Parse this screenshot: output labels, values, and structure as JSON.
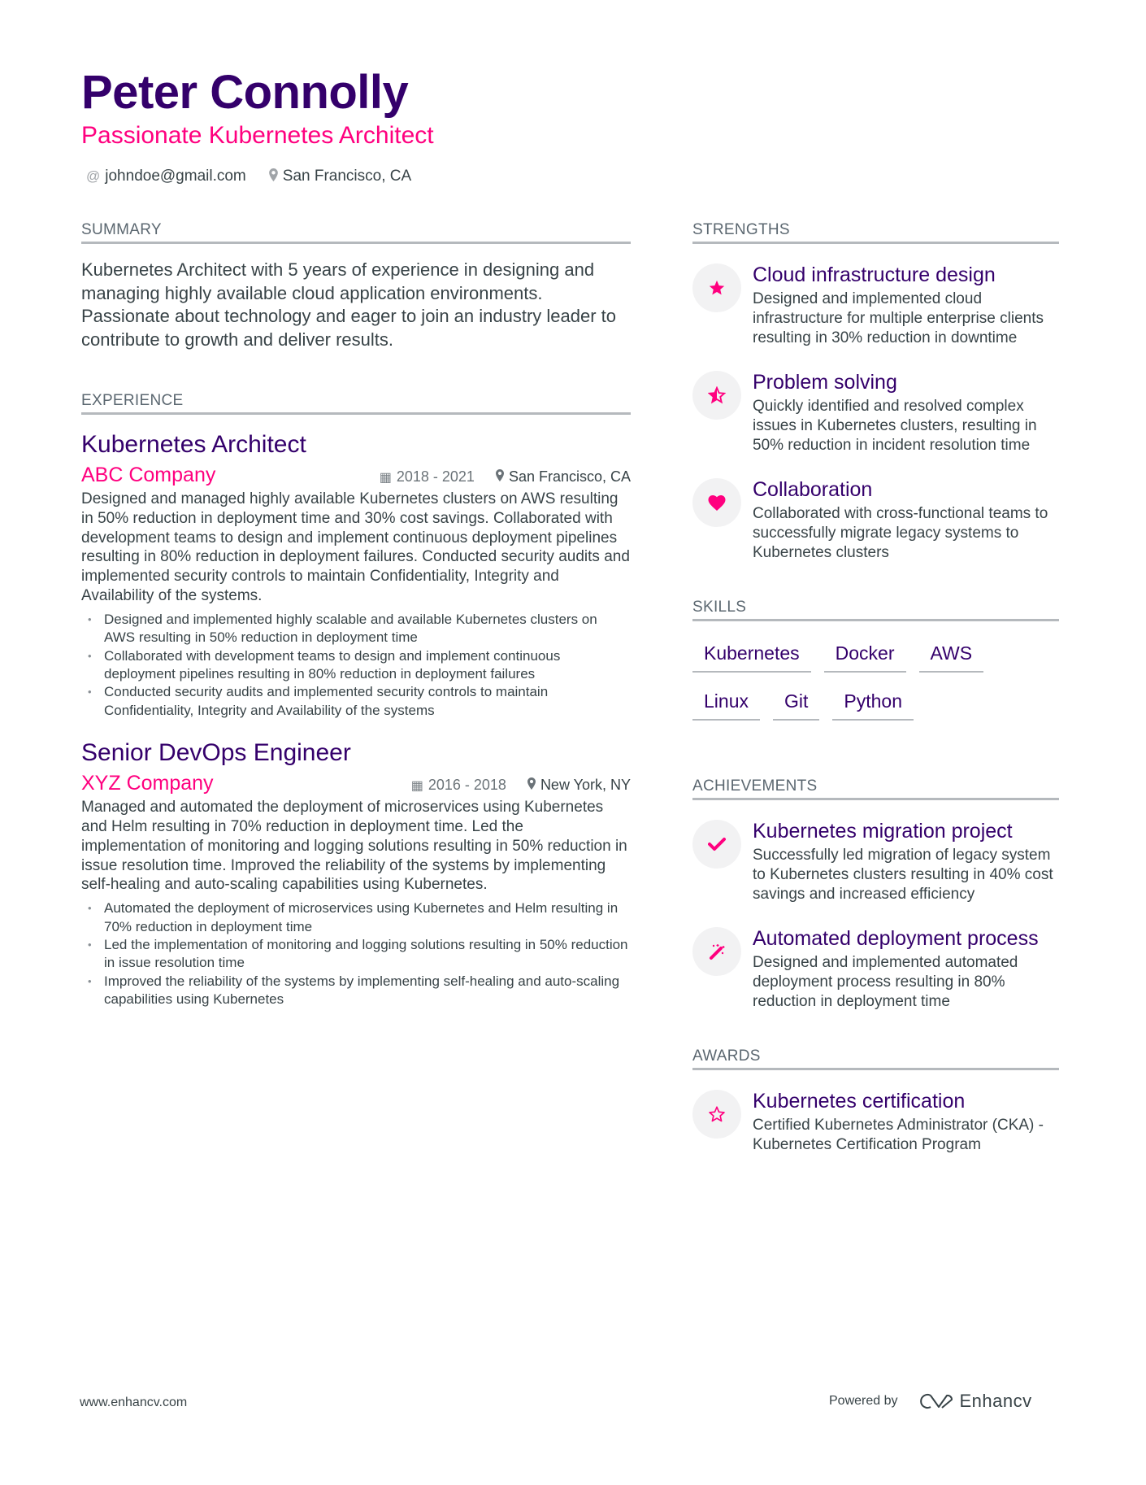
{
  "header": {
    "name": "Peter Connolly",
    "title": "Passionate Kubernetes Architect",
    "email": "johndoe@gmail.com",
    "location": "San Francisco, CA"
  },
  "summary": {
    "heading": "SUMMARY",
    "text": "Kubernetes Architect with 5 years of experience in designing and managing highly available cloud application environments. Passionate about technology and eager to join an industry leader to contribute to growth and deliver results."
  },
  "experience": {
    "heading": "EXPERIENCE",
    "jobs": [
      {
        "title": "Kubernetes Architect",
        "company": "ABC Company",
        "dates": "2018 - 2021",
        "location": "San Francisco, CA",
        "description": "Designed and managed highly available Kubernetes clusters on AWS resulting in 50% reduction in deployment time and 30% cost savings. Collaborated with development teams to design and implement continuous deployment pipelines resulting in 80% reduction in deployment failures. Conducted security audits and implemented security controls to maintain Confidentiality, Integrity and Availability of the systems.",
        "bullets": [
          "Designed and implemented highly scalable and available Kubernetes clusters on AWS resulting in 50% reduction in deployment time",
          "Collaborated with development teams to design and implement continuous deployment pipelines resulting in 80% reduction in deployment failures",
          "Conducted security audits and implemented security controls to maintain Confidentiality, Integrity and Availability of the systems"
        ]
      },
      {
        "title": "Senior DevOps Engineer",
        "company": "XYZ Company",
        "dates": "2016 - 2018",
        "location": "New York, NY",
        "description": "Managed and automated the deployment of microservices using Kubernetes and Helm resulting in 70% reduction in deployment time. Led the implementation of monitoring and logging solutions resulting in 50% reduction in issue resolution time. Improved the reliability of the systems by implementing self-healing and auto-scaling capabilities using Kubernetes.",
        "bullets": [
          "Automated the deployment of microservices using Kubernetes and Helm resulting in 70% reduction in deployment time",
          "Led the implementation of monitoring and logging solutions resulting in 50% reduction in issue resolution time",
          "Improved the reliability of the systems by implementing self-healing and auto-scaling capabilities using Kubernetes"
        ]
      }
    ]
  },
  "strengths": {
    "heading": "STRENGTHS",
    "items": [
      {
        "icon": "star-icon",
        "title": "Cloud infrastructure design",
        "description": "Designed and implemented cloud infrastructure for multiple enterprise clients resulting in 30% reduction in downtime"
      },
      {
        "icon": "half-star-icon",
        "title": "Problem solving",
        "description": "Quickly identified and resolved complex issues in Kubernetes clusters, resulting in 50% reduction in incident resolution time"
      },
      {
        "icon": "heart-icon",
        "title": "Collaboration",
        "description": "Collaborated with cross-functional teams to successfully migrate legacy systems to Kubernetes clusters"
      }
    ]
  },
  "skills": {
    "heading": "SKILLS",
    "items": [
      "Kubernetes",
      "Docker",
      "AWS",
      "Linux",
      "Git",
      "Python"
    ]
  },
  "achievements": {
    "heading": "ACHIEVEMENTS",
    "items": [
      {
        "icon": "checkmark-icon",
        "title": "Kubernetes migration project",
        "description": "Successfully led migration of legacy system to Kubernetes clusters resulting in 40% cost savings and increased efficiency"
      },
      {
        "icon": "magic-wand-icon",
        "title": "Automated deployment process",
        "description": "Designed and implemented automated deployment process resulting in 80% reduction in deployment time"
      }
    ]
  },
  "awards": {
    "heading": "AWARDS",
    "items": [
      {
        "icon": "star-outline-icon",
        "title": "Kubernetes certification",
        "description": "Certified Kubernetes Administrator (CKA) - Kubernetes Certification Program"
      }
    ]
  },
  "footer": {
    "website": "www.enhancv.com",
    "powered_by": "Powered by",
    "brand": "Enhancv"
  },
  "colors": {
    "name": "#34006b",
    "accent": "#ff007f",
    "text": "#384347",
    "divider": "#b5b9bd"
  }
}
